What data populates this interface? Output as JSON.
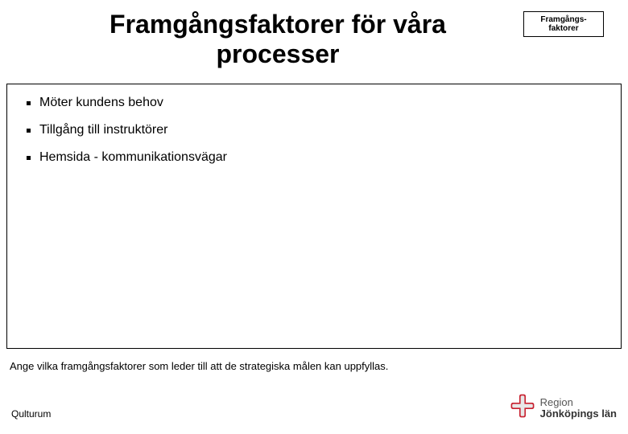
{
  "title": "Framgångsfaktorer för våra processer",
  "corner_label": "Framgångs-\nfaktorer",
  "bullets": {
    "items": [
      "Möter kundens behov",
      "Tillgång till instruktörer",
      "Hemsida - kommunikationsvägar"
    ]
  },
  "hint": "Ange vilka framgångsfaktorer som leder till att de strategiska målen kan uppfyllas.",
  "footer_left": "Qulturum",
  "logo": {
    "line1": "Region",
    "line2": "Jönköpings län"
  }
}
